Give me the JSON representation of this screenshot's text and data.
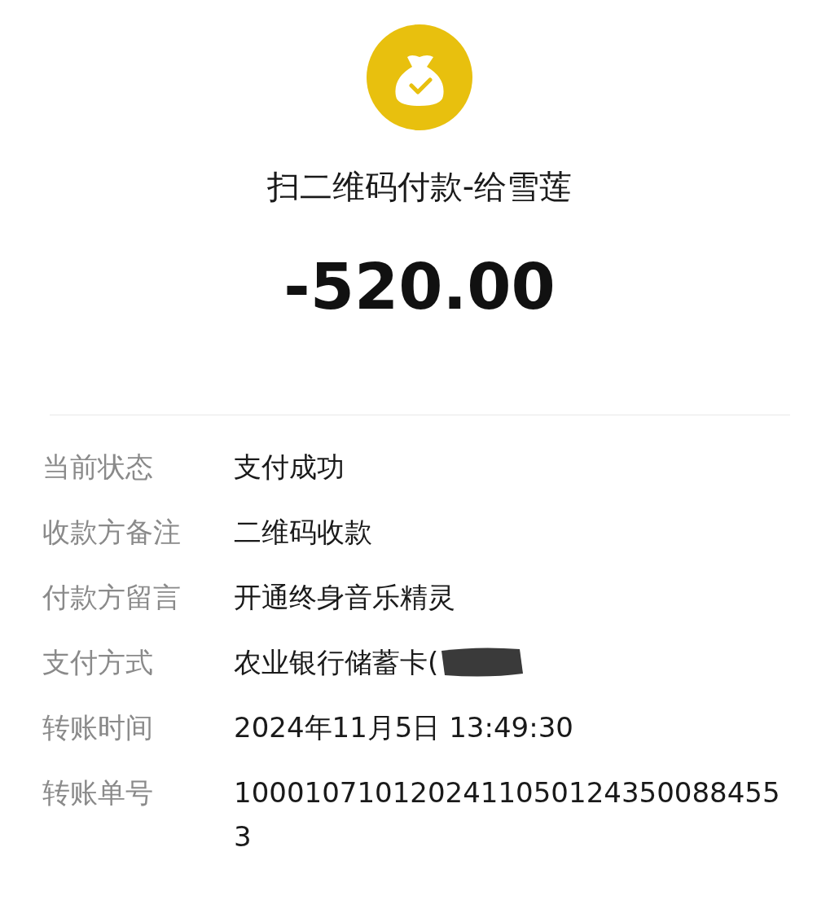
{
  "header": {
    "title": "扫二维码付款-给雪莲",
    "amount": "-520.00"
  },
  "details": [
    {
      "label": "当前状态",
      "value": "支付成功"
    },
    {
      "label": "收款方备注",
      "value": "二维码收款"
    },
    {
      "label": "付款方留言",
      "value": "开通终身音乐精灵"
    },
    {
      "label": "支付方式",
      "value": "农业银行储蓄卡(",
      "redacted": true
    },
    {
      "label": "转账时间",
      "value": "2024年11月5日 13:49:30"
    },
    {
      "label": "转账单号",
      "value": "1000107101202411050124350088455 3"
    }
  ]
}
